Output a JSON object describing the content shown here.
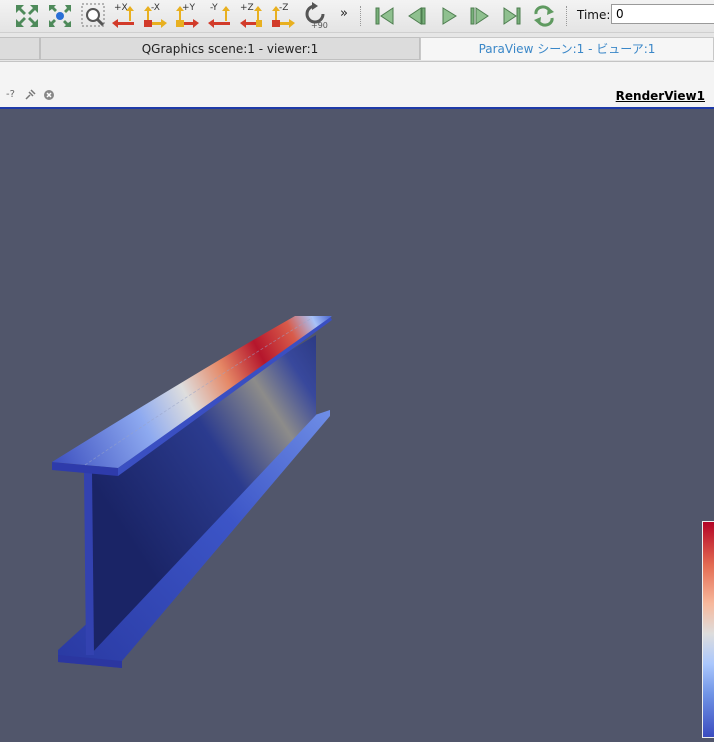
{
  "toolbar": {
    "buttons": [
      {
        "name": "reset-camera",
        "icon": "reset-camera-icon",
        "label": ""
      },
      {
        "name": "zoom-to-data",
        "icon": "zoom-to-data-icon",
        "label": ""
      },
      {
        "name": "zoom-to-box",
        "icon": "zoom-box-icon",
        "label": ""
      },
      {
        "name": "view-plus-x",
        "icon": "axis-plus-x-icon",
        "label": "+X"
      },
      {
        "name": "view-minus-x",
        "icon": "axis-minus-x-icon",
        "label": "-X"
      },
      {
        "name": "view-plus-y",
        "icon": "axis-plus-y-icon",
        "label": "+Y"
      },
      {
        "name": "view-minus-y",
        "icon": "axis-minus-y-icon",
        "label": "-Y"
      },
      {
        "name": "view-plus-z",
        "icon": "axis-plus-z-icon",
        "label": "+Z"
      },
      {
        "name": "view-minus-z",
        "icon": "axis-minus-z-icon",
        "label": "-Z"
      },
      {
        "name": "rotate-90",
        "icon": "rotate-90-icon",
        "label": "+90"
      }
    ],
    "more": "»",
    "playback": [
      "first-frame-icon",
      "previous-frame-icon",
      "play-icon",
      "next-frame-icon",
      "last-frame-icon",
      "loop-icon"
    ],
    "time_label": "Time:",
    "time_value": "0"
  },
  "tabs": [
    {
      "label": ""
    },
    {
      "label": "QGraphics scene:1 - viewer:1"
    },
    {
      "label": "ParaView シーン:1 - ビューア:1"
    }
  ],
  "view": {
    "title": "RenderView1",
    "header_icons": [
      "query-icon",
      "pick-icon",
      "close-icon"
    ],
    "header_query": "-?"
  },
  "colors": {
    "background": "#51566b",
    "colormap_high": "#b40426",
    "colormap_low": "#3b4cc0"
  }
}
